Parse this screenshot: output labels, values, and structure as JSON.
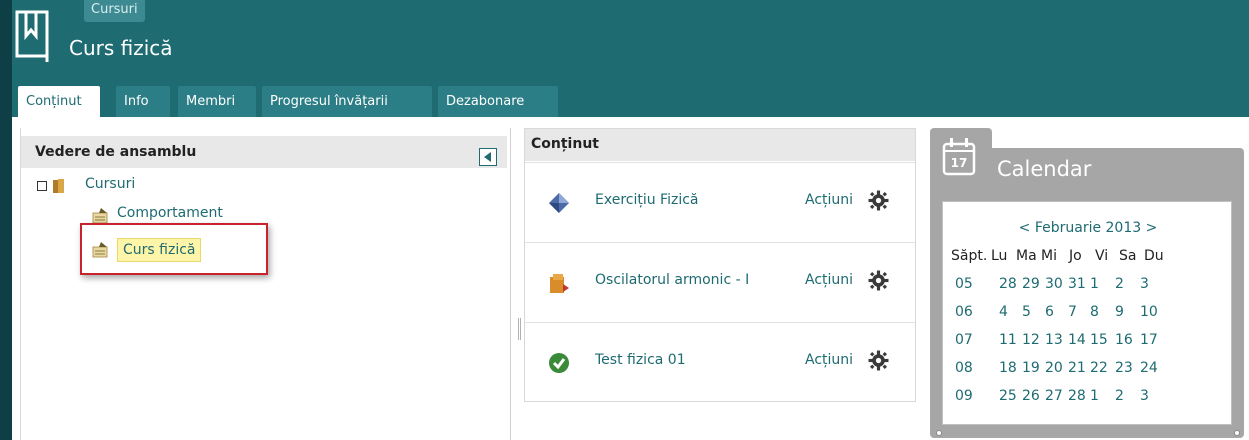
{
  "header": {
    "breadcrumb": "Cursuri",
    "title": "Curs fizică"
  },
  "tabs": [
    {
      "label": "Conținut",
      "active": true
    },
    {
      "label": "Info",
      "active": false
    },
    {
      "label": "Membri",
      "active": false
    },
    {
      "label": "Progresul învățarii",
      "active": false
    },
    {
      "label": "Dezabonare",
      "active": false
    }
  ],
  "overview": {
    "title": "Vedere de ansamblu",
    "tree": {
      "root": "Cursuri",
      "children": [
        "Comportament",
        "Curs fizică"
      ],
      "selected": "Curs fizică"
    }
  },
  "content_panel": {
    "title": "Conținut",
    "items": [
      {
        "name": "Exercițiu Fizică",
        "actions": "Acțiuni",
        "icon": "exercise-diamond-icon"
      },
      {
        "name": "Oscilatorul armonic - I",
        "actions": "Acțiuni",
        "icon": "learning-module-icon"
      },
      {
        "name": "Test fizica 01",
        "actions": "Acțiuni",
        "icon": "test-check-icon"
      }
    ]
  },
  "calendar": {
    "title": "Calendar",
    "icon_day": "17",
    "month_nav": "< Februarie 2013 >",
    "headers": [
      "Săpt.",
      "Lu",
      "Ma",
      "Mi",
      "Jo",
      "Vi",
      "Sa",
      "Du"
    ],
    "weeks": [
      {
        "week": "05",
        "days": [
          "28",
          "29",
          "30",
          "31",
          "1",
          "2",
          "3"
        ]
      },
      {
        "week": "06",
        "days": [
          "4",
          "5",
          "6",
          "7",
          "8",
          "9",
          "10"
        ]
      },
      {
        "week": "07",
        "days": [
          "11",
          "12",
          "13",
          "14",
          "15",
          "16",
          "17"
        ]
      },
      {
        "week": "08",
        "days": [
          "18",
          "19",
          "20",
          "21",
          "22",
          "23",
          "24"
        ]
      },
      {
        "week": "09",
        "days": [
          "25",
          "26",
          "27",
          "28",
          "1",
          "2",
          "3"
        ]
      }
    ]
  },
  "colors": {
    "brand": "#1e6b72",
    "highlight": "#fff5a8",
    "selection_border": "#c8232c"
  }
}
